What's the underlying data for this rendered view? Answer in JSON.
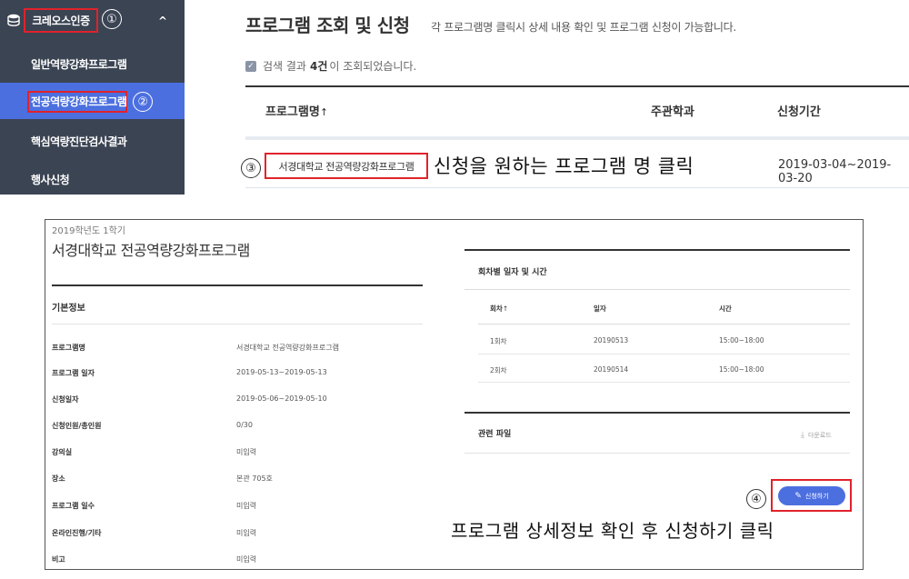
{
  "sidebar": {
    "title": "크레오스인증",
    "step1": "①",
    "chevron": "^",
    "items": [
      {
        "label": "일반역량강화프로그램"
      },
      {
        "label": "전공역량강화프로그램"
      },
      {
        "label": "핵심역량진단검사결과"
      },
      {
        "label": "행사신청"
      }
    ],
    "step2": "②"
  },
  "list": {
    "title": "프로그램 조회 및 신청",
    "subtitle": "각 프로그램명 클릭시 상세 내용 확인 및 프로그램 신청이 가능합니다.",
    "result_prefix": "검색 결과",
    "result_count": "4건",
    "result_suffix": "이 조회되었습니다.",
    "columns": {
      "name": "프로그램명",
      "sort_arrow": "↑",
      "dept": "주관학과",
      "period": "신청기간"
    },
    "row": {
      "name": "서경대학교 전공역량강화프로그램",
      "period": "2019-03-04~2019-03-20"
    },
    "step3": "③",
    "annotation": "신청을 원하는 프로그램 명 클릭"
  },
  "detail": {
    "semester": "2019학년도 1학기",
    "title": "서경대학교 전공역량강화프로그램",
    "basic_info_title": "기본정보",
    "fields": [
      {
        "label": "프로그램명",
        "value": "서경대학교 전공역량강화프로그램"
      },
      {
        "label": "프로그램 일자",
        "value": "2019-05-13~2019-05-13"
      },
      {
        "label": "신청일자",
        "value": "2019-05-06~2019-05-10"
      },
      {
        "label": "신청인원/총인원",
        "value": "0/30"
      },
      {
        "label": "강의실",
        "value": "미입력"
      },
      {
        "label": "장소",
        "value": "본관 705호"
      },
      {
        "label": "프로그램 일수",
        "value": "미입력"
      },
      {
        "label": "온라인진행/기타",
        "value": "미입력"
      },
      {
        "label": "비고",
        "value": "미입력"
      }
    ],
    "schedule_title": "회차별 일자 및 시간",
    "schedule_columns": {
      "round": "회차",
      "sort_arrow": "↑",
      "date": "일자",
      "time": "시간"
    },
    "schedule": [
      {
        "round": "1회차",
        "date": "20190513",
        "time": "15:00~18:00"
      },
      {
        "round": "2회차",
        "date": "20190514",
        "time": "15:00~18:00"
      }
    ],
    "files_title": "관련 파일",
    "download_label": "다운로드",
    "apply_label": "신청하기",
    "step4": "④",
    "annotation": "프로그램 상세정보 확인 후 신청하기 클릭"
  },
  "colors": {
    "sidebar_bg": "#3b4453",
    "accent": "#4c6fe0",
    "highlight": "#e0222b"
  }
}
